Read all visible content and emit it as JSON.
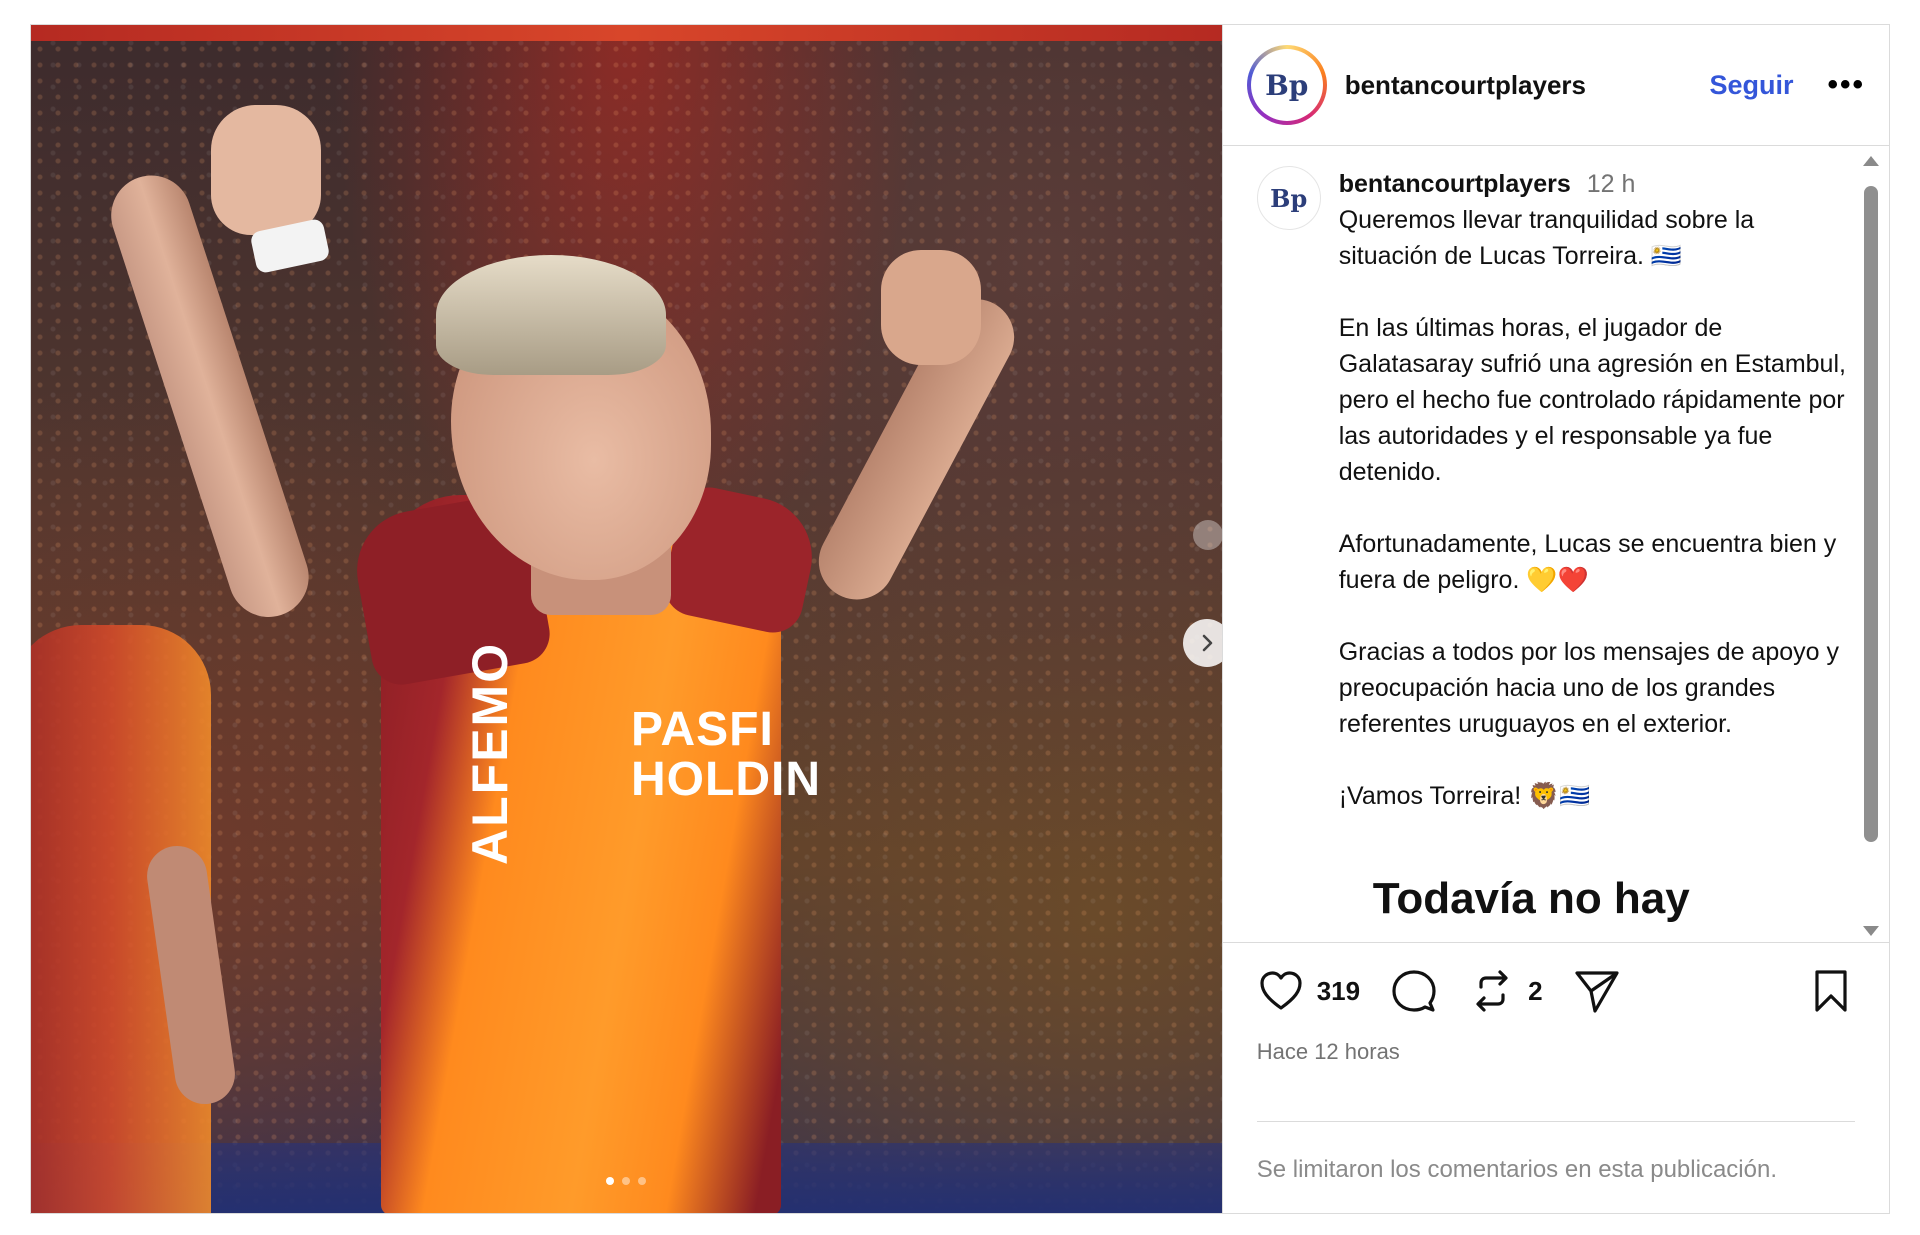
{
  "media": {
    "sponsor_line1": "PASFI",
    "sponsor_line2": "HOLDIN",
    "side_text": "ALFEMO",
    "dots_count": 3,
    "active_dot": 0
  },
  "header": {
    "avatar_initials": "Bp",
    "username": "bentancourtplayers",
    "follow_label": "Seguir",
    "more_label": "•••"
  },
  "caption": {
    "avatar_initials": "Bp",
    "username": "bentancourtplayers",
    "time": "12 h",
    "paragraphs": [
      "Queremos llevar tranquilidad sobre la situación de Lucas Torreira. 🇺🇾",
      "En las últimas horas, el jugador de Galatasaray sufrió una agresión en Estambul, pero el hecho fue controlado rápidamente por las autoridades y el responsable ya fue detenido.",
      "Afortunadamente, Lucas se encuentra bien y fuera de peligro. 💛❤️",
      "Gracias a todos por los mensajes de apoyo y preocupación hacia uno de los grandes referentes uruguayos en el exterior.",
      "¡Vamos Torreira! 🦁🇺🇾"
    ],
    "no_comments": "Todavía no hay comentarios."
  },
  "actions": {
    "likes": "319",
    "reposts": "2",
    "time_ago": "Hace 12 horas",
    "icons": [
      "heart-icon",
      "comment-icon",
      "repost-icon",
      "share-icon",
      "bookmark-icon"
    ]
  },
  "footer": {
    "limited_text": "Se limitaron los comentarios en esta publicación."
  },
  "colors": {
    "follow": "#3456d9",
    "border": "#dbdbdb",
    "muted": "#737373"
  }
}
